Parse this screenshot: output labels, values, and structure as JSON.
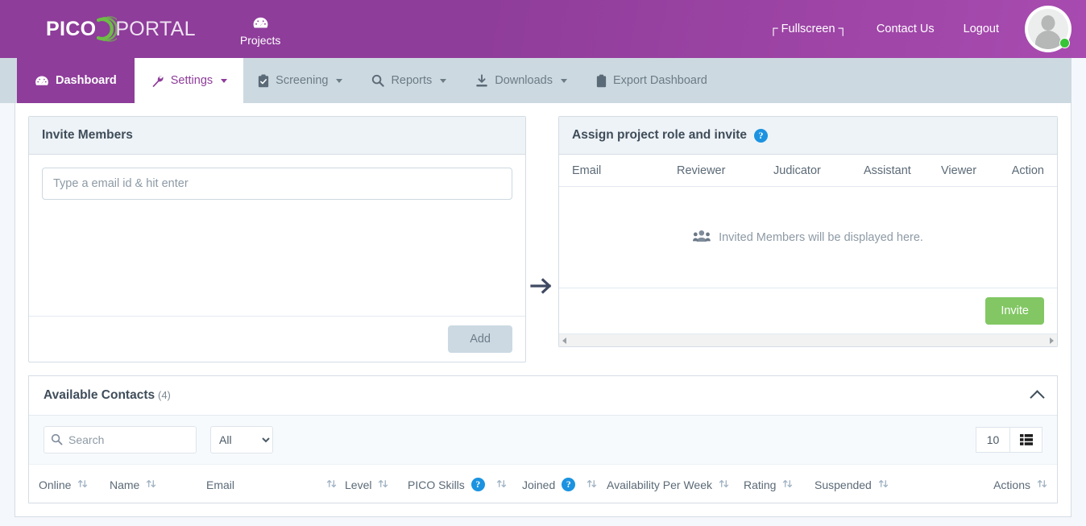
{
  "header": {
    "logo": {
      "part1": "PICO",
      "part2": "PORTAL",
      "icon": "pico-swoosh-logo"
    },
    "projects": {
      "label": "Projects",
      "icon": "tachometer-icon"
    },
    "fullscreen": {
      "label": "Fullscreen",
      "left_bracket": "⌐",
      "right_bracket": "¬"
    },
    "contact": "Contact Us",
    "logout": "Logout",
    "avatar": {
      "icon": "user-avatar",
      "status": "online",
      "status_color": "#37c437"
    },
    "brand_color": "#8e3d9a"
  },
  "nav": {
    "tabs": [
      {
        "label": "Dashboard",
        "icon": "tachometer-icon",
        "state": "active-primary",
        "caret": false
      },
      {
        "label": "Settings",
        "icon": "wrench-icon",
        "state": "active-white",
        "caret": true
      },
      {
        "label": "Screening",
        "icon": "clipboard-check-icon",
        "state": "default",
        "caret": true
      },
      {
        "label": "Reports",
        "icon": "search-icon",
        "state": "default",
        "caret": true
      },
      {
        "label": "Downloads",
        "icon": "download-icon",
        "state": "default",
        "caret": true
      },
      {
        "label": "Export Dashboard",
        "icon": "clipboard-icon",
        "state": "default",
        "caret": false
      }
    ]
  },
  "invite_members": {
    "title": "Invite Members",
    "email_input_placeholder": "Type a email id & hit enter",
    "email_input_value": "",
    "add_label": "Add"
  },
  "arrow": {
    "icon": "arrow-right-icon"
  },
  "assign_panel": {
    "title": "Assign project role and invite",
    "help_icon": "question-mark-icon",
    "columns": [
      "Email",
      "Reviewer",
      "Judicator",
      "Assistant",
      "Viewer",
      "Action"
    ],
    "rows": [],
    "empty_message": "Invited Members will be displayed here.",
    "empty_icon": "users-icon",
    "invite_label": "Invite",
    "invite_color": "#82c763",
    "scrollbar": {
      "left_icon": "caret-left-icon",
      "right_icon": "caret-right-icon"
    }
  },
  "contacts": {
    "title": "Available Contacts",
    "count": "(4)",
    "collapse_icon": "chevron-up-icon",
    "search_placeholder": "Search",
    "search_value": "",
    "search_icon": "search-icon",
    "filter": {
      "selected": "All",
      "options": [
        "All"
      ]
    },
    "page_size": "10",
    "grid_icon": "table-grid-icon",
    "columns": [
      {
        "label": "Online",
        "sortable": true,
        "help": false
      },
      {
        "label": "Name",
        "sortable": true,
        "help": false
      },
      {
        "label": "Email",
        "sortable": true,
        "help": false
      },
      {
        "label": "Level",
        "sortable": true,
        "help": false
      },
      {
        "label": "PICO Skills",
        "sortable": true,
        "help": true
      },
      {
        "label": "Joined",
        "sortable": true,
        "help": true
      },
      {
        "label": "Availability Per Week",
        "sortable": true,
        "help": false
      },
      {
        "label": "Rating",
        "sortable": true,
        "help": false
      },
      {
        "label": "Suspended",
        "sortable": true,
        "help": false
      },
      {
        "label": "Actions",
        "sortable": true,
        "help": false
      }
    ]
  }
}
